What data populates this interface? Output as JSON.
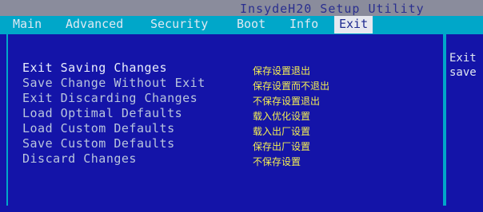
{
  "title": "InsydeH20 Setup Utility",
  "menu": [
    "Main",
    "Advanced",
    "Security",
    "Boot",
    "Info",
    "Exit"
  ],
  "options": [
    {
      "label": "Exit Saving Changes",
      "note": "保存设置退出"
    },
    {
      "label": "Save Change Without Exit",
      "note": "保存设置而不退出"
    },
    {
      "label": "Exit Discarding Changes",
      "note": "不保存设置退出"
    },
    {
      "label": "Load Optimal Defaults",
      "note": "载入优化设置"
    },
    {
      "label": "Load Custom Defaults",
      "note": "载入出厂设置"
    },
    {
      "label": "Save Custom Defaults",
      "note": "保存出厂设置"
    },
    {
      "label": "Discard Changes",
      "note": "不保存设置"
    }
  ],
  "help": {
    "line1": "Exit",
    "line2": "save"
  },
  "colors": {
    "background": "#1414a8",
    "menu_bar": "#00a7c9",
    "title_bar": "#8a8c9c",
    "note_text": "#f4ef53"
  }
}
